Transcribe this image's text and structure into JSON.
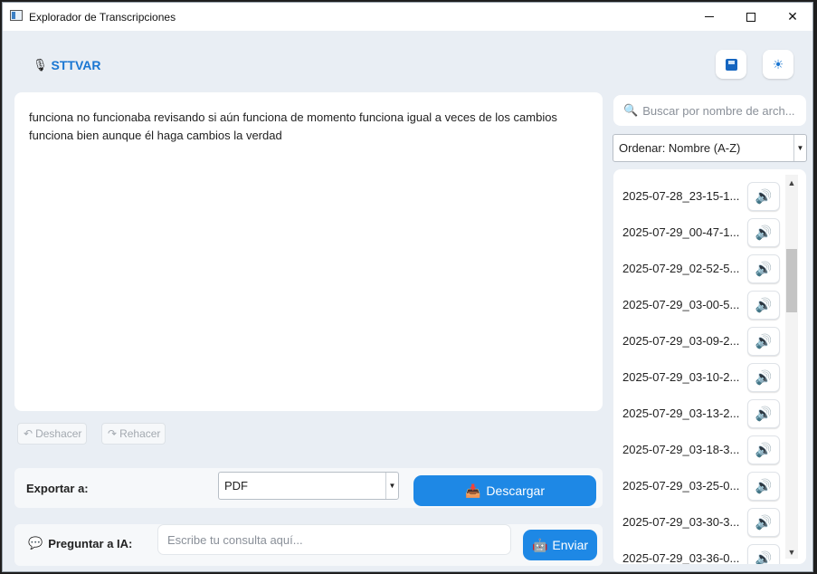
{
  "window": {
    "title": "Explorador de Transcripciones"
  },
  "header": {
    "logo_icon": "microphone-icon",
    "brand": "STTVAR",
    "save_icon": "save-icon",
    "theme_icon": "sun-icon"
  },
  "transcript": {
    "text": "funciona no funcionaba revisando si aún funciona de momento funciona igual a veces de los cambios funciona bien aunque él haga cambios la verdad"
  },
  "edit": {
    "undo_label": "Deshacer",
    "redo_label": "Rehacer"
  },
  "export": {
    "label": "Exportar a:",
    "format": "PDF",
    "download_label": "Descargar"
  },
  "ask": {
    "label": "Preguntar a IA:",
    "placeholder": "Escribe tu consulta aquí...",
    "send_label": "Enviar"
  },
  "search": {
    "placeholder": "Buscar por nombre de arch..."
  },
  "sort": {
    "selected": "Ordenar: Nombre (A-Z)"
  },
  "files": [
    "2025-07-28_23-15-1...",
    "2025-07-29_00-47-1...",
    "2025-07-29_02-52-5...",
    "2025-07-29_03-00-5...",
    "2025-07-29_03-09-2...",
    "2025-07-29_03-10-2...",
    "2025-07-29_03-13-2...",
    "2025-07-29_03-18-3...",
    "2025-07-29_03-25-0...",
    "2025-07-29_03-30-3...",
    "2025-07-29_03-36-0..."
  ],
  "colors": {
    "accent": "#1e88e5",
    "brand": "#1976d2",
    "background": "#e9eef4"
  }
}
